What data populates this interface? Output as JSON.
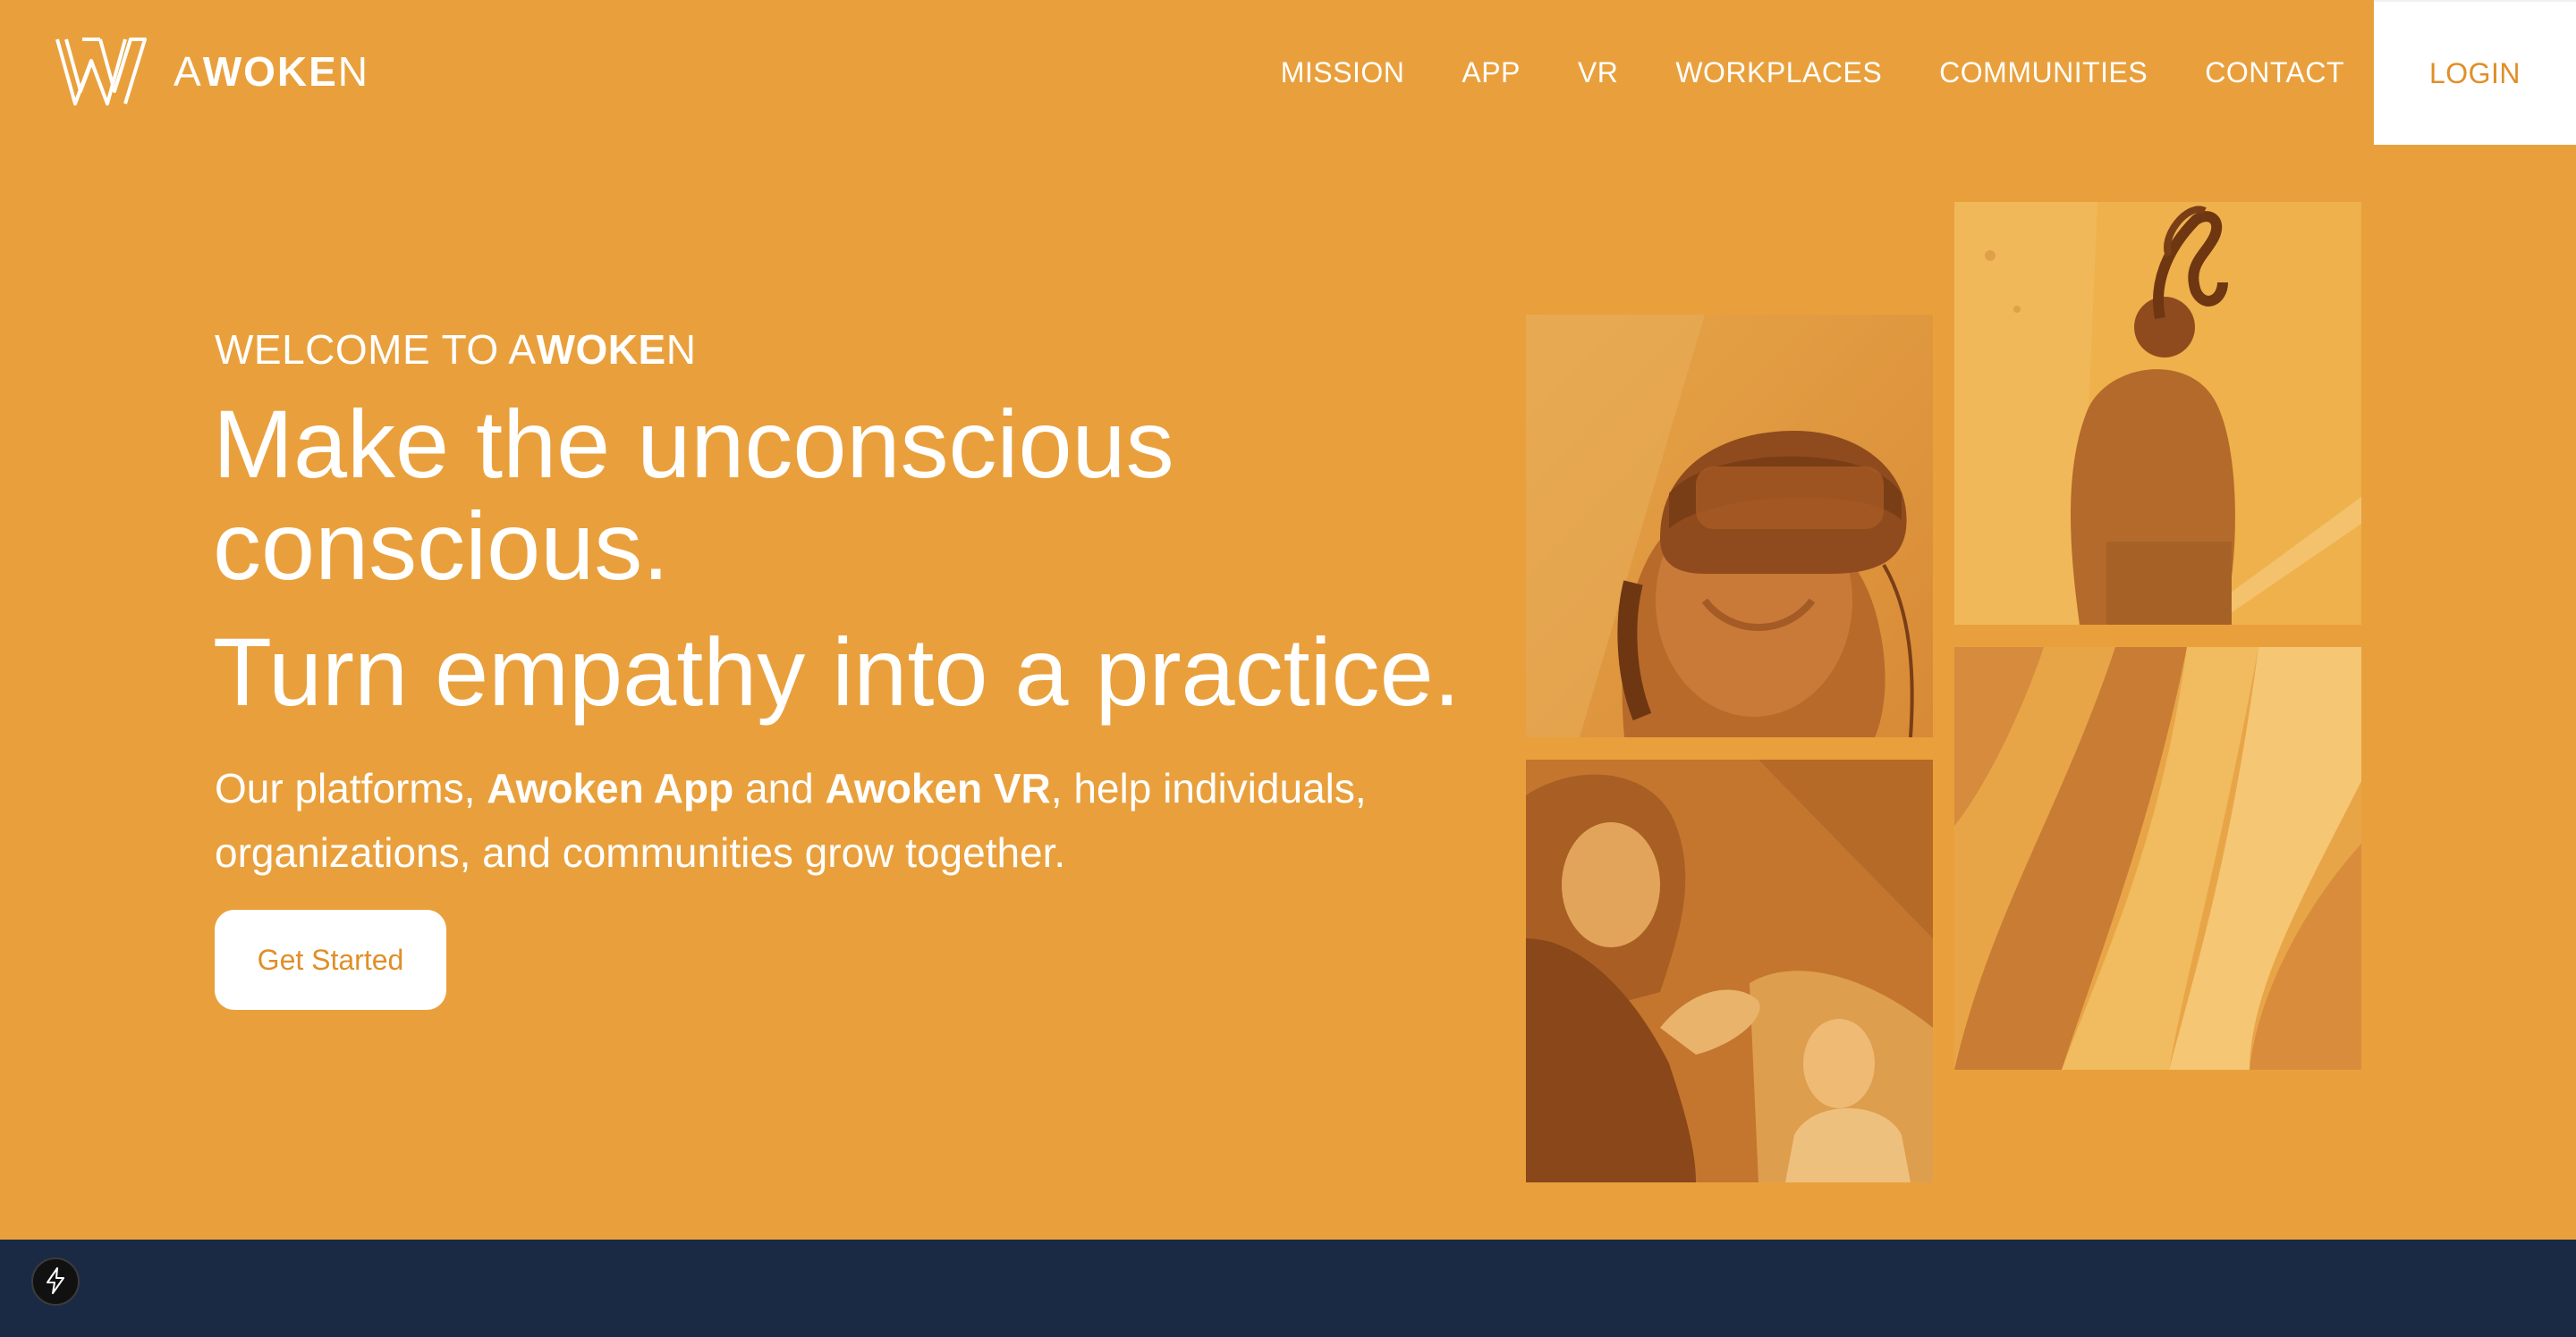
{
  "brand": {
    "name_light_a": "A",
    "name_bold": "WOKE",
    "name_light_b": "N"
  },
  "nav": {
    "items": [
      {
        "label": "MISSION"
      },
      {
        "label": "APP"
      },
      {
        "label": "VR"
      },
      {
        "label": "WORKPLACES"
      },
      {
        "label": "COMMUNITIES"
      },
      {
        "label": "CONTACT"
      }
    ],
    "login_label": "LOGIN"
  },
  "hero": {
    "eyebrow_prefix": "WELCOME TO A",
    "eyebrow_bold": "WOKE",
    "eyebrow_suffix": "N",
    "headline_line1": "Make the unconscious",
    "headline_line2": "conscious.",
    "headline_line3": "Turn empathy into a practice.",
    "desc_part1": "Our platforms, ",
    "desc_app": "Awoken App",
    "desc_part2": " and ",
    "desc_vr": "Awoken VR",
    "desc_part3": ", help individuals, organizations, and communities grow together.",
    "cta_label": "Get Started"
  },
  "icons": {
    "logo": "awoken-w-logo-icon",
    "fab": "lightning-bolt-icon"
  },
  "colors": {
    "background": "#e9a03c",
    "accent": "#e08f28",
    "footer": "#1b2a44",
    "white": "#ffffff"
  }
}
